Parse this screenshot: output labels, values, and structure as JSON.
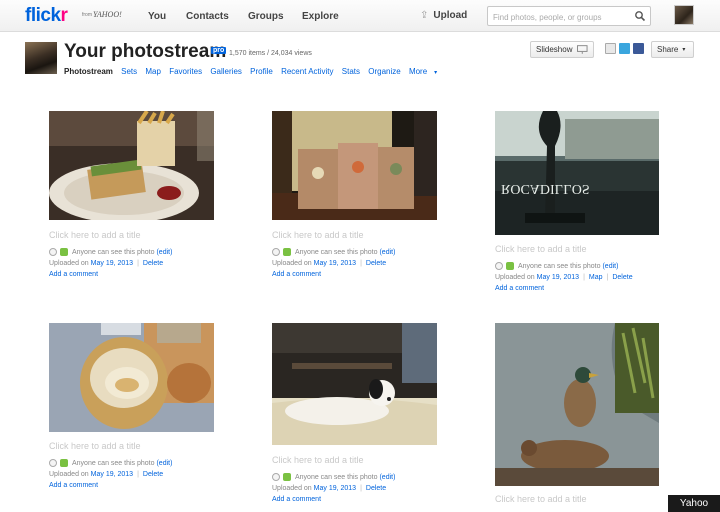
{
  "brand": {
    "logo_main": "flick",
    "logo_accent": "r",
    "logo_from": "from",
    "logo_yahoo": "YAHOO!"
  },
  "nav": {
    "you": "You",
    "contacts": "Contacts",
    "groups": "Groups",
    "explore": "Explore",
    "upload": "Upload"
  },
  "search": {
    "placeholder": "Find photos, people, or groups"
  },
  "header": {
    "title": "Your photostream",
    "badge": "pro",
    "stats": "1,570 items / 24,034 views",
    "slideshow": "Slideshow",
    "share": "Share"
  },
  "subnav": [
    "Photostream",
    "Sets",
    "Map",
    "Favorites",
    "Galleries",
    "Profile",
    "Recent Activity",
    "Stats",
    "Organize",
    "More"
  ],
  "photo_meta": {
    "title_prompt": "Click here to add a title",
    "visibility": "Anyone can see this photo",
    "edit": "(edit)",
    "uploaded_prefix": "Uploaded on",
    "date": "May 19, 2013",
    "delete": "Delete",
    "map": "Map",
    "add_comment": "Add a comment"
  },
  "footer": {
    "watermark": "Yahoo"
  }
}
